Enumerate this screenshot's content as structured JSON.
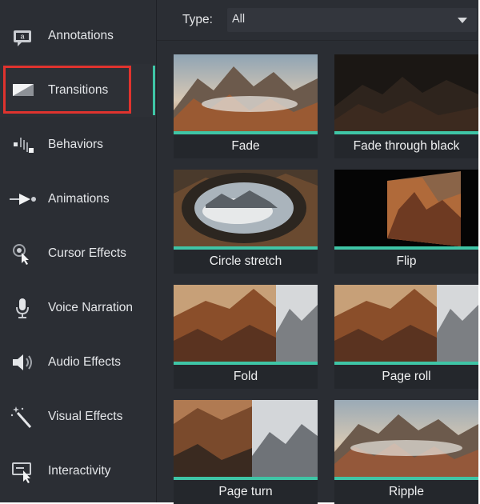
{
  "sidebar": {
    "items": [
      {
        "label": "Annotations",
        "icon": "annotation-icon"
      },
      {
        "label": "Transitions",
        "icon": "transitions-icon"
      },
      {
        "label": "Behaviors",
        "icon": "behaviors-icon"
      },
      {
        "label": "Animations",
        "icon": "animations-icon"
      },
      {
        "label": "Cursor Effects",
        "icon": "cursor-effects-icon"
      },
      {
        "label": "Voice Narration",
        "icon": "microphone-icon"
      },
      {
        "label": "Audio Effects",
        "icon": "speaker-icon"
      },
      {
        "label": "Visual Effects",
        "icon": "magic-wand-icon"
      },
      {
        "label": "Interactivity",
        "icon": "interactivity-icon"
      }
    ],
    "annotation_icon_letter": "a",
    "selected": "Transitions"
  },
  "filter": {
    "label": "Type:",
    "value": "All"
  },
  "transitions": [
    {
      "name": "Fade"
    },
    {
      "name": "Fade through black"
    },
    {
      "name": "Circle stretch"
    },
    {
      "name": "Flip"
    },
    {
      "name": "Fold"
    },
    {
      "name": "Page roll"
    },
    {
      "name": "Page turn"
    },
    {
      "name": "Ripple"
    }
  ],
  "colors": {
    "accent": "#3fc5a6",
    "highlight": "#e0332e",
    "panel": "#2a2d33"
  }
}
